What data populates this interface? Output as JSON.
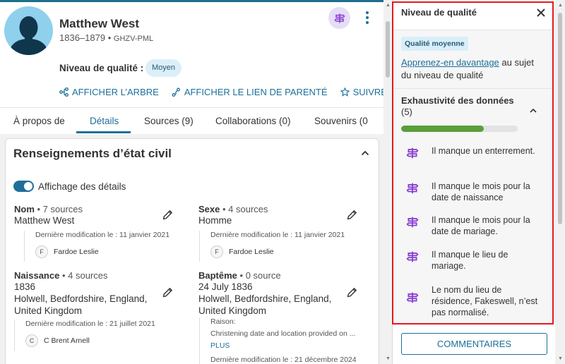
{
  "person": {
    "name": "Matthew West",
    "dates": "1836–1879",
    "separator": "•",
    "id": "GHZV-PML",
    "quality_label": "Niveau de qualité :",
    "quality_badge": "Moyen"
  },
  "actions": {
    "tree": "AFFICHER L’ARBRE",
    "relationship": "AFFICHER LE LIEN DE PARENTÉ",
    "follow": "SUIVRE"
  },
  "tabs": [
    {
      "label": "À propos de"
    },
    {
      "label": "Détails",
      "active": true
    },
    {
      "label": "Sources (9)"
    },
    {
      "label": "Collaborations (0)"
    },
    {
      "label": "Souvenirs (0"
    }
  ],
  "vitals": {
    "title": "Renseignements d’état civil",
    "toggle_label": "Affichage des détails",
    "fields": {
      "name": {
        "label": "Nom",
        "sources": "• 7 sources",
        "value": "Matthew West",
        "modified": "Dernière modification le : 11 janvier 2021",
        "user_initial": "F",
        "user": "Fardoe Leslie"
      },
      "sex": {
        "label": "Sexe",
        "sources": "• 4 sources",
        "value": "Homme",
        "modified": "Dernière modification le : 11 janvier 2021",
        "user_initial": "F",
        "user": "Fardoe Leslie"
      },
      "birth": {
        "label": "Naissance",
        "sources": "• 4 sources",
        "date": "1836",
        "place_line1": "Holwell, Bedfordshire, England,",
        "place_line2": "United Kingdom",
        "modified": "Dernière modification le : 21 juillet 2021",
        "user_initial": "C",
        "user": "C Brent Arnell"
      },
      "baptism": {
        "label": "Baptême",
        "sources": "• 0 source",
        "date": "24 July 1836",
        "place_line1": "Holwell, Bedfordshire, England,",
        "place_line2": "United Kingdom",
        "reason_label": "Raison:",
        "reason_text": "Christening date and location provided on ...",
        "more": "PLUS",
        "modified": "Dernière modification le : 21 décembre 2024"
      }
    }
  },
  "quality_panel": {
    "title": "Niveau de qualité",
    "badge": "Qualité moyenne",
    "learn_link": "Apprenez-en davantage",
    "learn_rest": " au sujet du niveau de qualité",
    "completeness_title": "Exhaustivité des données",
    "completeness_count": "(5)",
    "progress": 0.71,
    "hints": [
      "Il manque un enterrement.",
      "Il manque le mois pour la date de naissance",
      "Il manque le mois pour la date de mariage.",
      "Il manque le lieu de mariage.",
      "Le nom du lieu de résidence, Fakeswell, n’est pas normalisé."
    ],
    "comments_button": "COMMENTAIRES"
  },
  "colors": {
    "accent": "#1d6f9a",
    "hint_icon": "#8a3fd1",
    "highlight_border": "#e3191f",
    "progress_fill": "#5a9e3a"
  },
  "icons": [
    "person-silhouette-icon",
    "research-hint-icon",
    "more-vertical-icon",
    "tree-icon",
    "relationship-icon",
    "star-icon",
    "chevron-up-icon",
    "pencil-icon",
    "close-icon"
  ]
}
